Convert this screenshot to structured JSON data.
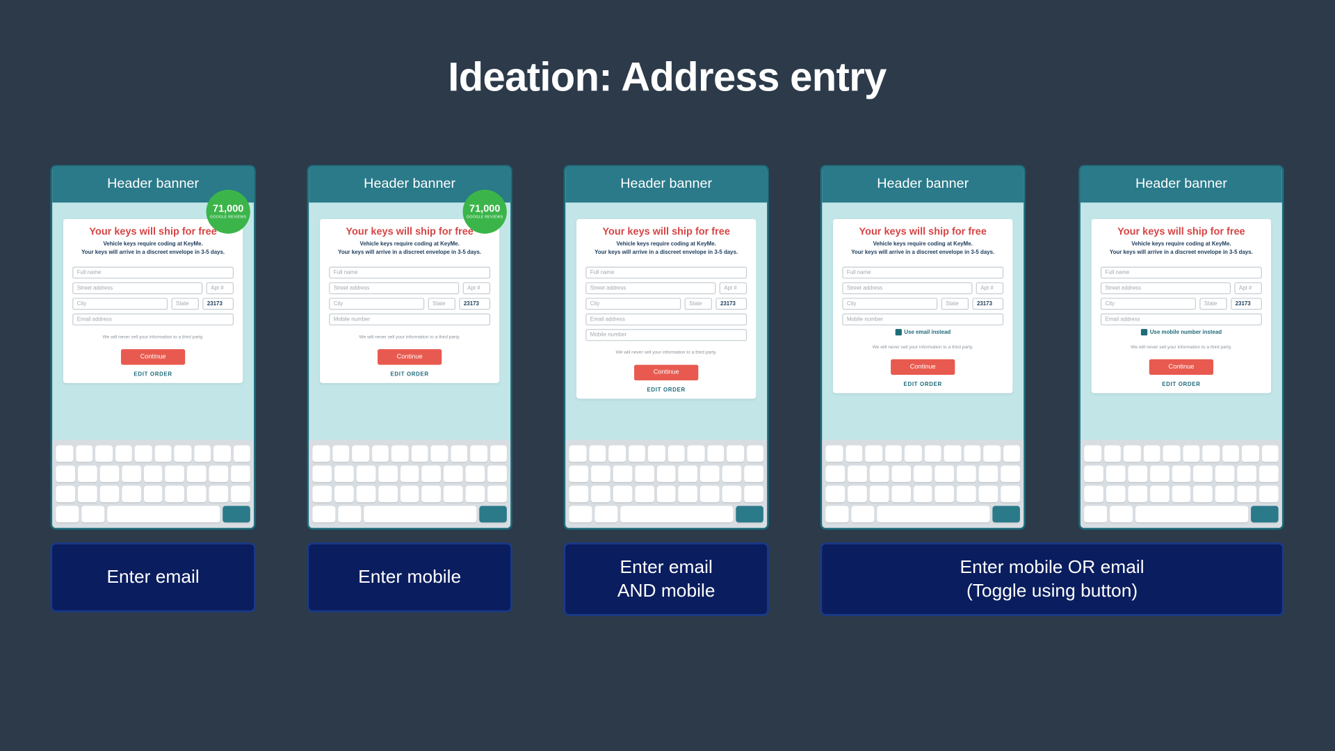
{
  "title": "Ideation: Address entry",
  "common": {
    "header": "Header banner",
    "headline": "Your keys will ship for free",
    "sub1": "Vehicle keys require coding at KeyMe.",
    "sub2": "Your keys will arrive in a discreet envelope in 3-5 days.",
    "fullname": "Full name",
    "street": "Street address",
    "apt": "Apt #",
    "city": "City",
    "state": "State",
    "zip": "23173",
    "email": "Email address",
    "mobile": "Mobile number",
    "disclaimer": "We will never sell your information to a third party.",
    "continue": "Continue",
    "edit": "EDIT ORDER",
    "badge_num": "71,000",
    "badge_sub": "GOOGLE REVIEWS",
    "toggle_email": "Use email instead",
    "toggle_mobile": "Use mobile number instead"
  },
  "captions": {
    "c1": "Enter email",
    "c2": "Enter mobile",
    "c3": "Enter email\nAND mobile",
    "c4": "Enter mobile OR email\n(Toggle using button)"
  }
}
